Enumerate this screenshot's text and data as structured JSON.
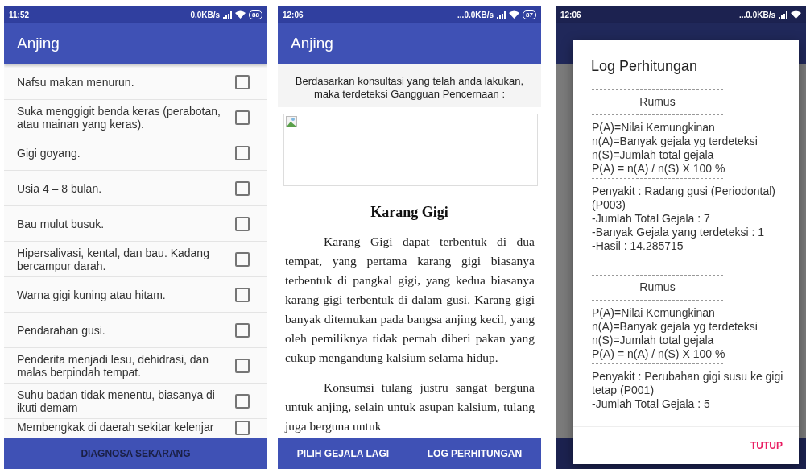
{
  "phones": [
    {
      "kind": "symptoms",
      "status": {
        "time": "11:52",
        "speed": "0.0KB/s",
        "battery": "88"
      },
      "app_bar": {
        "title": "Anjing"
      },
      "symptoms": [
        {
          "label": "Nafsu makan menurun.",
          "checked": false
        },
        {
          "label": "Suka menggigit benda keras (perabotan, atau mainan yang keras).",
          "checked": false
        },
        {
          "label": "Gigi goyang.",
          "checked": false
        },
        {
          "label": "Usia 4 – 8 bulan.",
          "checked": false
        },
        {
          "label": "Bau mulut busuk.",
          "checked": false
        },
        {
          "label": "Hipersalivasi, kental, dan bau. Kadang bercampur darah.",
          "checked": false
        },
        {
          "label": "Warna gigi kuning atau hitam.",
          "checked": false
        },
        {
          "label": "Pendarahan gusi.",
          "checked": false
        },
        {
          "label": "Penderita menjadi lesu, dehidrasi, dan malas berpindah tempat.",
          "checked": false
        },
        {
          "label": "Suhu badan tidak menentu, biasanya di ikuti demam",
          "checked": false
        },
        {
          "label": "Membengkak di daerah sekitar kelenjar",
          "checked": false
        }
      ],
      "button": "DIAGNOSA SEKARANG"
    },
    {
      "kind": "result",
      "status": {
        "time": "12:06",
        "speed": "...0.0KB/s",
        "battery": "87"
      },
      "app_bar": {
        "title": "Anjing"
      },
      "intro": "Berdasarkan konsultasi yang telah anda lakukan, maka terdeteksi Gangguan Pencernaan :",
      "disease_title": "Karang Gigi",
      "paragraphs": [
        "Karang Gigi dapat terbentuk di dua tempat, yang pertama karang gigi biasanya terbentuk di pangkal gigi, yang kedua biasanya karang gigi terbentuk di dalam gusi. Karang gigi banyak ditemukan pada bangsa anjing kecil, yang oleh pemiliknya tidak pernah diberi pakan yang cukup mengandung kalsium selama hidup.",
        "Konsumsi tulang justru sangat berguna untuk anjing, selain untuk asupan kalsium, tulang juga berguna untuk"
      ],
      "actions": [
        "PILIH GEJALA LAGI",
        "LOG PERHITUNGAN"
      ]
    },
    {
      "kind": "dialog",
      "status": {
        "time": "12:06",
        "speed": "...0.0KB/s"
      },
      "dialog": {
        "title": "Log Perhitungan",
        "blocks": [
          {
            "kind": "divider"
          },
          {
            "kind": "heading",
            "text": "Rumus"
          },
          {
            "kind": "divider"
          },
          {
            "kind": "line",
            "text": "P(A)=Nilai Kemungkinan"
          },
          {
            "kind": "line",
            "text": "n(A)=Banyak gejala yg terdeteksi"
          },
          {
            "kind": "line",
            "text": "n(S)=Jumlah total gejala"
          },
          {
            "kind": "line",
            "text": "P(A) = n(A) / n(S) X 100 %"
          },
          {
            "kind": "divider"
          },
          {
            "kind": "line",
            "text": "Penyakit : Radang gusi (Periodontal) (P003)"
          },
          {
            "kind": "line",
            "text": "-Jumlah Total Gejala : 7"
          },
          {
            "kind": "line",
            "text": "-Banyak Gejala yang terdeteksi : 1"
          },
          {
            "kind": "line",
            "text": "-Hasil : 14.285715"
          },
          {
            "kind": "gap"
          },
          {
            "kind": "divider"
          },
          {
            "kind": "heading",
            "text": "Rumus"
          },
          {
            "kind": "divider"
          },
          {
            "kind": "line",
            "text": "P(A)=Nilai Kemungkinan"
          },
          {
            "kind": "line",
            "text": "n(A)=Banyak gejala yg terdeteksi"
          },
          {
            "kind": "line",
            "text": "n(S)=Jumlah total gejala"
          },
          {
            "kind": "line",
            "text": "P(A) = n(A) / n(S) X 100 %"
          },
          {
            "kind": "divider"
          },
          {
            "kind": "line",
            "text": "Penyakit : Perubahan gigi susu ke gigi tetap (P001)"
          },
          {
            "kind": "line",
            "text": "-Jumlah Total Gejala : 5"
          }
        ],
        "button": "TUTUP"
      }
    }
  ]
}
